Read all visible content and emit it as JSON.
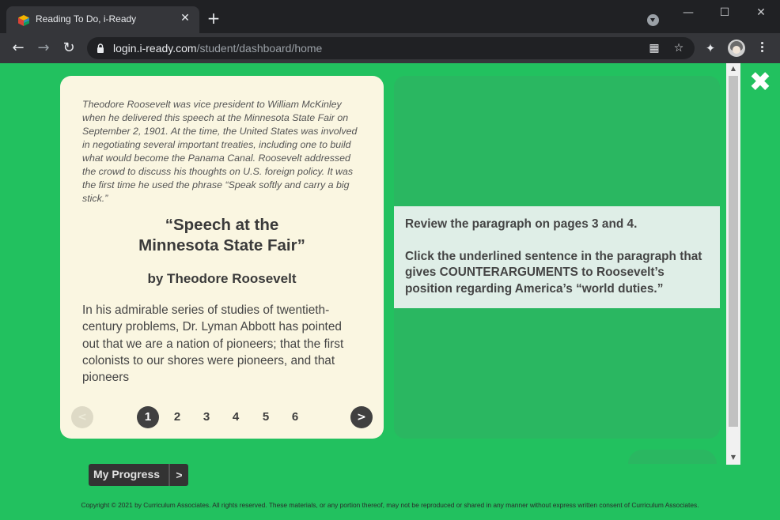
{
  "browser": {
    "tab_title": "Reading To Do, i-Ready",
    "url_host": "login.i-ready.com",
    "url_path": "/student/dashboard/home",
    "icons": [
      "back-arrow-icon",
      "forward-arrow-icon",
      "reload-icon",
      "lock-icon",
      "qr-code-icon",
      "star-icon",
      "extensions-icon",
      "more-vert-icon"
    ]
  },
  "passage": {
    "intro": "Theodore Roosevelt was vice president to William McKinley when he delivered this speech at the Minnesota State Fair on September 2, 1901. At the time, the United States was involved in negotiating several important treaties, including one to build what would become the Panama Canal. Roosevelt addressed the crowd to discuss his thoughts on U.S. foreign policy. It was the first time he used the phrase “Speak softly and carry a big stick.”",
    "title_line1": "“Speech at the",
    "title_line2": "Minnesota State Fair”",
    "author": "by Theodore Roosevelt",
    "body": "In his admirable series of studies of twentieth-century problems, Dr. Lyman Abbott has pointed out that we are a nation of pioneers; that the first colonists to our shores were pioneers, and that pioneers"
  },
  "pager": {
    "prev_label": "<",
    "next_label": ">",
    "pages": [
      "1",
      "2",
      "3",
      "4",
      "5",
      "6"
    ],
    "current_page": "1"
  },
  "question": {
    "line1": "Review the paragraph on pages 3 and 4.",
    "line2": "Click the underlined sentence in the paragraph that gives COUNTERARGUMENTS to Roosevelt’s position regarding America’s “world duties.”"
  },
  "progress_button": {
    "label": "My Progress",
    "arrow": ">"
  },
  "copyright": "Copyright © 2021 by Curriculum Associates. All rights reserved. These materials, or any portion thereof, may not be reproduced or shared in any manner without express written consent of Curriculum Associates.",
  "colors": {
    "page_bg": "#22c15f",
    "card_bg": "#faf6e1",
    "panel_bg": "#2ab761",
    "prompt_bg": "#dfeee7"
  }
}
